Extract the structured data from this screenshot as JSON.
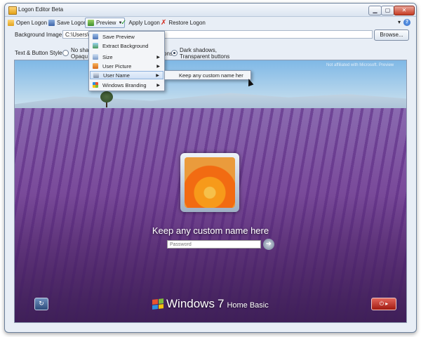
{
  "window": {
    "title": "Logon Editor Beta",
    "min_icon": "minimize-icon",
    "max_icon": "maximize-icon",
    "close_icon": "close-icon"
  },
  "toolbar": {
    "open": "Open Logon",
    "save": "Save Logon",
    "preview": "Preview",
    "apply": "Apply Logon",
    "restore": "Restore Logon"
  },
  "background": {
    "label": "Background Image",
    "path": "C:\\Users\\",
    "browse": "Browse..."
  },
  "style": {
    "label": "Text & Button Style",
    "option1": "No sha",
    "option1_line2": "Opaqu",
    "option2_part": "ons",
    "option3": "Dark shadows,",
    "option3_line2": "Transparent buttons"
  },
  "preview_menu": {
    "items": [
      {
        "label": "Save Preview",
        "icon": "save-preview-icon",
        "has_submenu": false
      },
      {
        "label": "Extract Background",
        "icon": "picture-icon",
        "has_submenu": false
      },
      {
        "label": "Size",
        "icon": "size-icon",
        "has_submenu": true
      },
      {
        "label": "User Picture",
        "icon": "user-picture-icon",
        "has_submenu": true
      },
      {
        "label": "User Name",
        "icon": "user-name-icon",
        "has_submenu": true
      },
      {
        "label": "Windows Branding",
        "icon": "windows-flag-icon",
        "has_submenu": true
      }
    ],
    "submenu_item": "Keep any custom name her"
  },
  "logon": {
    "user_name": "Keep any custom name here",
    "password_placeholder": "Password",
    "brand_windows": "Windows",
    "brand_version": "7",
    "brand_edition": "Home Basic",
    "watermark": "Not affiliated with Microsoft. Preview"
  },
  "colors": {
    "accent": "#2d62c2",
    "power": "#c12a1f"
  }
}
